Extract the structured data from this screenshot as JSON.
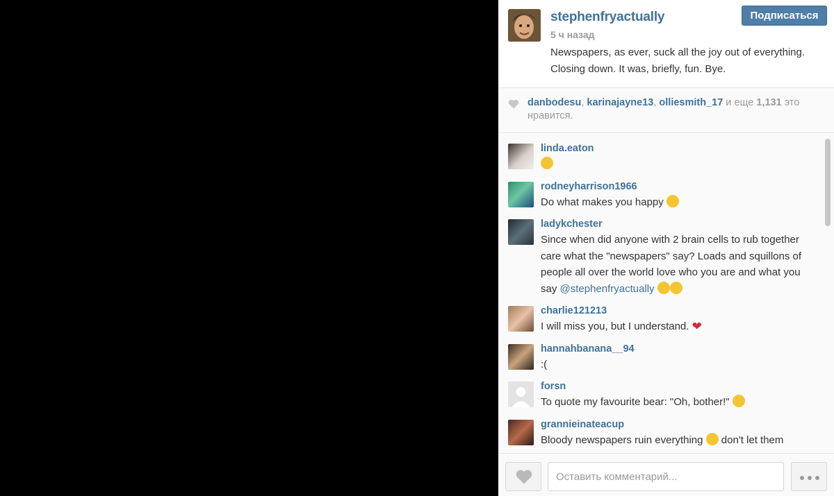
{
  "post": {
    "author": "stephenfryactually",
    "time": "5 ч назад",
    "caption": "Newspapers, as ever, suck all the joy out of everything. Closing down. It was, briefly, fun. Bye.",
    "follow_label": "Подписаться"
  },
  "likes": {
    "users": [
      "danbodesu",
      "karinajayne13",
      "olliesmith_17"
    ],
    "sep": ", ",
    "and_more": " и еще ",
    "count": "1,131",
    "suffix": " это нравится."
  },
  "comments": [
    {
      "user": "linda.eaton",
      "text": "",
      "emoji": "sad-face"
    },
    {
      "user": "rodneyharrison1966",
      "text": "Do what makes you happy ",
      "emoji": "smile-face"
    },
    {
      "user": "ladykchester",
      "text": "Since when did anyone with 2 brain cells to rub together care what the \"newspapers\" say? Loads and squillons of people all over the world love who you are and what you say ",
      "mention": "@stephenfryactually",
      "emoji": "heart-eyes"
    },
    {
      "user": "charlie121213",
      "text": "I will miss you, but I understand. ",
      "emoji": "broken-heart"
    },
    {
      "user": "hannahbanana__94",
      "text": ":("
    },
    {
      "user": "forsn",
      "text": "To quote my favourite bear: \"Oh, bother!\" ",
      "emoji": "disappointed-face"
    },
    {
      "user": "grannieinateacup",
      "text": "Bloody newspapers ruin everything ",
      "emoji": "persevere-face",
      "text_after": " don't let them"
    }
  ],
  "footer": {
    "comment_placeholder": "Оставить комментарий..."
  },
  "colors": {
    "link": "#3f729b",
    "follow_bg": "#4f7ea8"
  }
}
